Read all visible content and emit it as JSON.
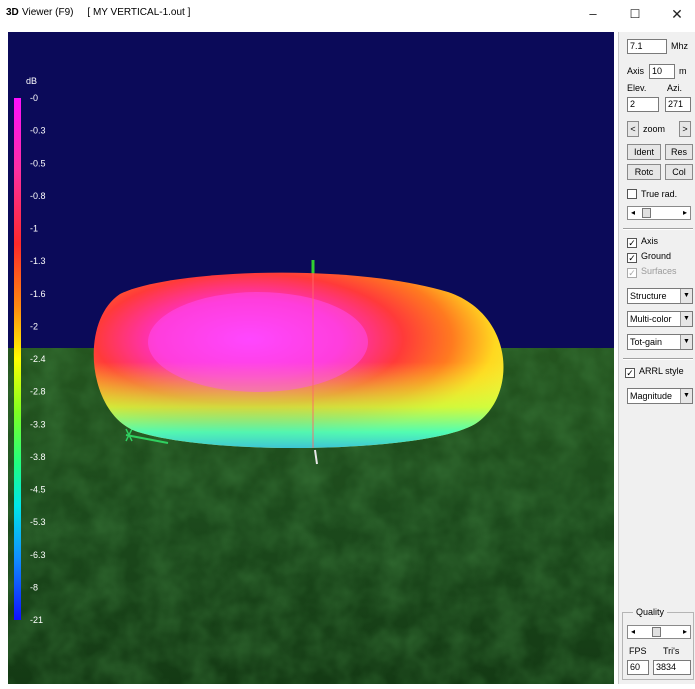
{
  "window": {
    "app_label": "3D",
    "title": "Viewer (F9)     [ MY VERTICAL-1.out ]",
    "minimize_glyph": "–",
    "maximize_glyph": "☐",
    "close_glyph": "✕"
  },
  "colors": {
    "sky": "#0b0a59",
    "ground": "#1c4a1c",
    "panel_bg": "#f0f0f0"
  },
  "scale": {
    "unit": "dB",
    "ticks": [
      "-0",
      "-0.3",
      "-0.5",
      "-0.8",
      "-1",
      "-1.3",
      "-1.6",
      "-2",
      "-2.4",
      "-2.8",
      "-3.3",
      "-3.8",
      "-4.5",
      "-5.3",
      "-6.3",
      "-8",
      "-21"
    ]
  },
  "panel": {
    "freq_value": "7.1",
    "freq_unit": "Mhz",
    "axis_label": "Axis",
    "axis_value": "10",
    "axis_unit": "m",
    "elev_label": "Elev.",
    "azi_label": "Azi.",
    "elev_value": "2",
    "azi_value": "271",
    "zoom_prev": "<",
    "zoom_label": "zoom",
    "zoom_next": ">",
    "ident_label": "Ident",
    "reset_label": "Res",
    "rotate_label": "Rotc",
    "color_label": "Col",
    "true_rad_label": "True rad.",
    "true_rad_checked": false,
    "axis_check_label": "Axis",
    "axis_checked": true,
    "ground_check_label": "Ground",
    "ground_checked": true,
    "surfaces_check_label": "Surfaces",
    "surfaces_checked": true,
    "dropdown_structure": "Structure",
    "dropdown_color": "Multi-color",
    "dropdown_gain": "Tot-gain",
    "arrl_label": "ARRL style",
    "arrl_checked": true,
    "dropdown_magnitude": "Magnitude",
    "quality_label": "Quality",
    "fps_label": "FPS",
    "tris_label": "Tri's",
    "fps_value": "60",
    "tris_value": "3834"
  }
}
